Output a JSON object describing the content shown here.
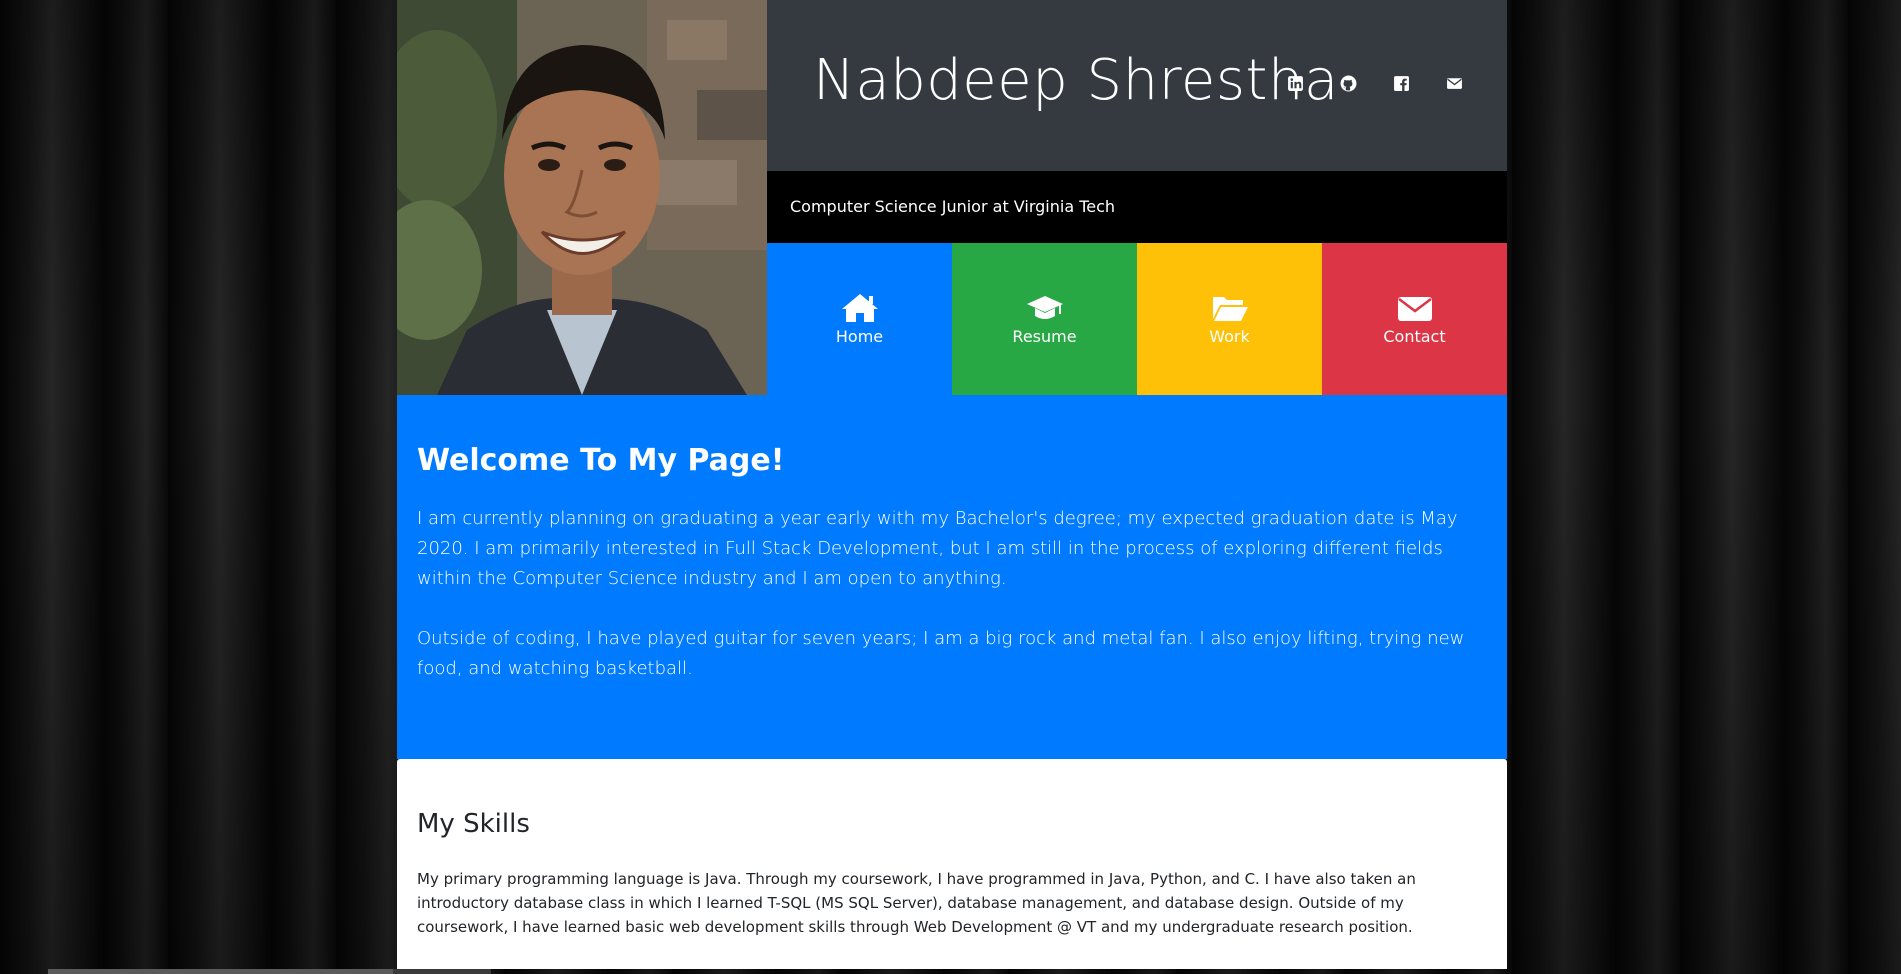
{
  "header": {
    "name": "Nabdeep Shrestha",
    "subtitle": "Computer Science Junior at Virginia Tech",
    "social": [
      {
        "icon": "linkedin-icon"
      },
      {
        "icon": "github-icon"
      },
      {
        "icon": "facebook-icon"
      },
      {
        "icon": "email-icon"
      }
    ]
  },
  "nav": {
    "items": [
      {
        "label": "Home",
        "icon": "home-icon",
        "color": "#007bff"
      },
      {
        "label": "Resume",
        "icon": "graduation-cap-icon",
        "color": "#28a745"
      },
      {
        "label": "Work",
        "icon": "folder-open-icon",
        "color": "#ffc107"
      },
      {
        "label": "Contact",
        "icon": "envelope-icon",
        "color": "#dc3545"
      }
    ]
  },
  "welcome": {
    "heading": "Welcome To My Page!",
    "paragraph1": "I am currently planning on graduating a year early with my Bachelor's degree; my expected graduation date is May 2020. I am primarily interested in Full Stack Development, but I am still in the process of exploring different fields within the Computer Science industry and I am open to anything.",
    "paragraph2": "Outside of coding, I have played guitar for seven years; I am a big rock and metal fan. I also enjoy lifting, trying new food, and watching basketball."
  },
  "skills": {
    "heading": "My Skills",
    "paragraph": "My primary programming language is Java. Through my coursework, I have programmed in Java, Python, and C. I have also taken an introductory database class in which I learned T-SQL (MS SQL Server), database management, and database design. Outside of my coursework, I have learned basic web development skills through Web Development @ VT and my undergraduate research position."
  },
  "colors": {
    "title_bar": "#343a40",
    "welcome_bg": "#007bff"
  }
}
